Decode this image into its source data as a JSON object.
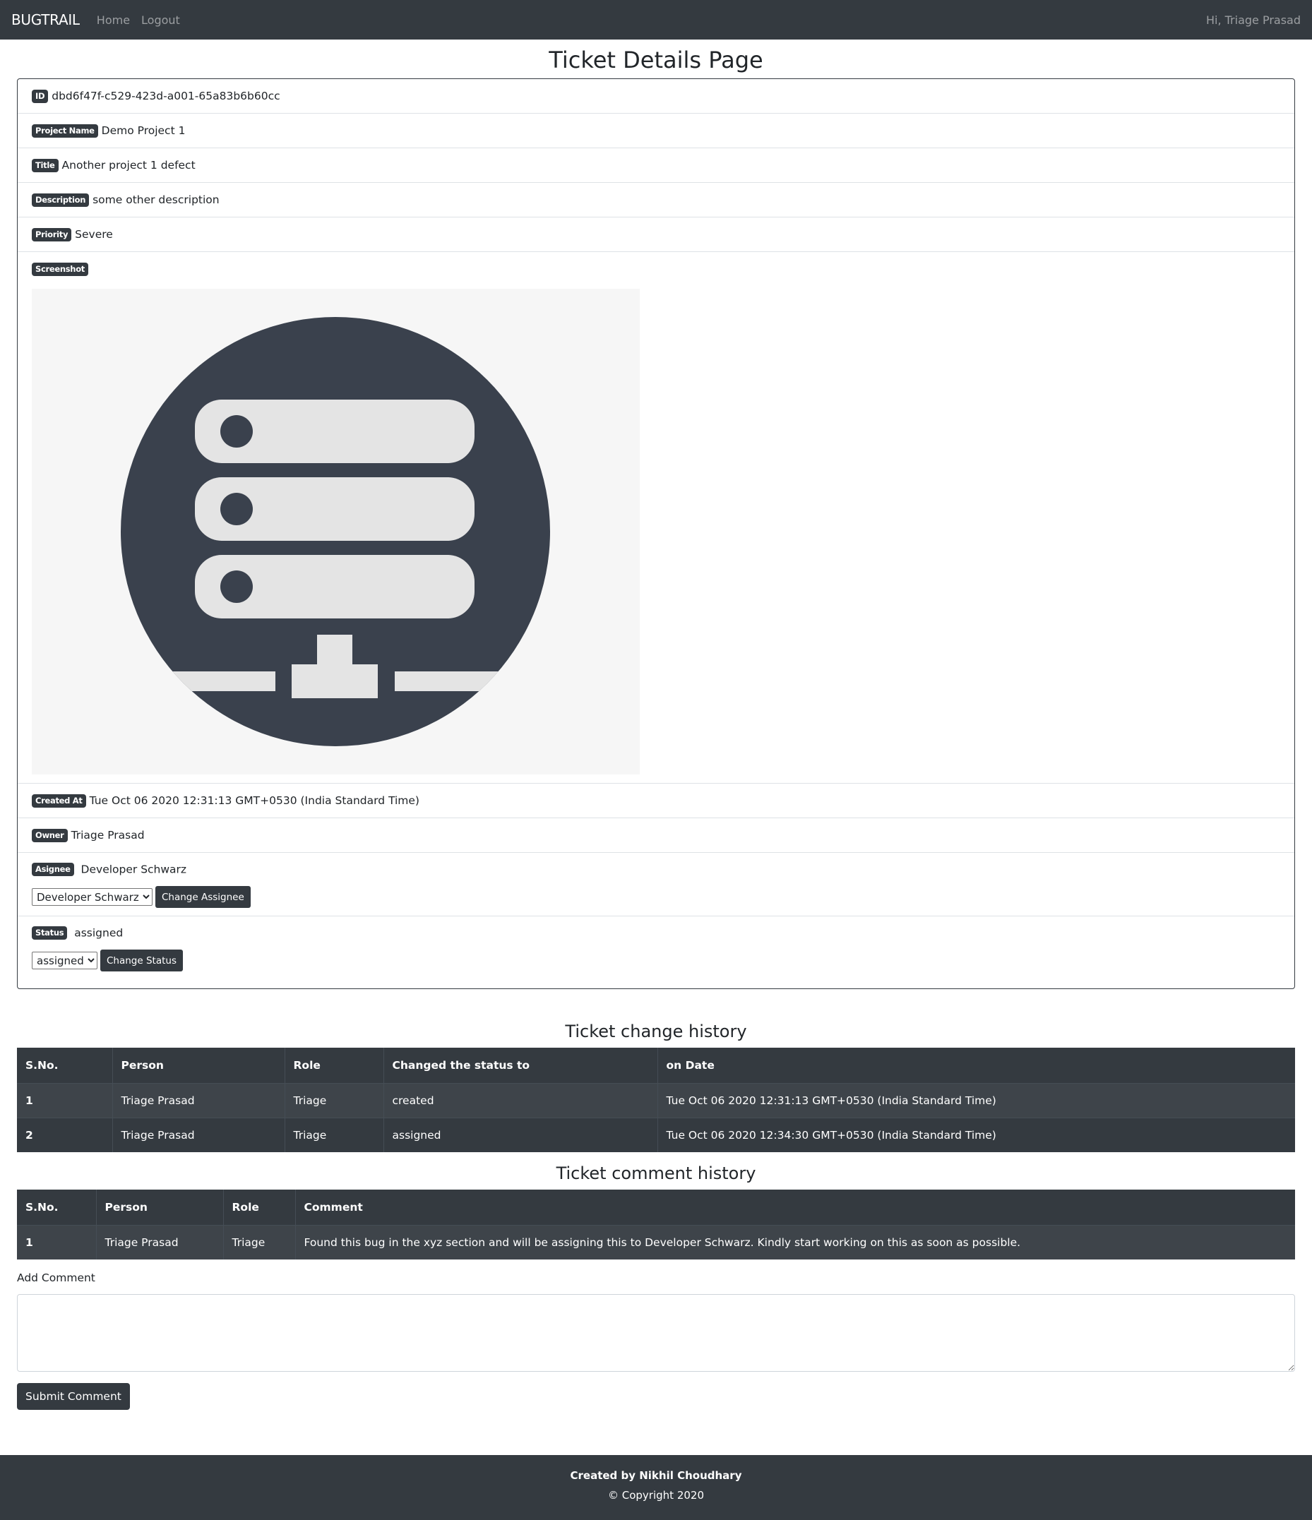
{
  "navbar": {
    "brand": "BUGTRAIL",
    "links": [
      "Home",
      "Logout"
    ],
    "greeting": "Hi, Triage Prasad"
  },
  "page_title": "Ticket Details Page",
  "ticket": {
    "id": {
      "label": "ID",
      "value": "dbd6f47f-c529-423d-a001-65a83b6b60cc"
    },
    "project_name": {
      "label": "Project Name",
      "value": "Demo Project 1"
    },
    "title": {
      "label": "Title",
      "value": "Another project 1 defect"
    },
    "description": {
      "label": "Description",
      "value": "some other description"
    },
    "priority": {
      "label": "Priority",
      "value": "Severe"
    },
    "screenshot": {
      "label": "Screenshot",
      "image_icon": "server-network-icon",
      "colors": {
        "background": "#f6f6f6",
        "circle": "#3a414d",
        "shape": "#e4e4e4"
      }
    },
    "created_at": {
      "label": "Created At",
      "value": "Tue Oct 06 2020 12:31:13 GMT+0530 (India Standard Time)"
    },
    "owner": {
      "label": "Owner",
      "value": "Triage Prasad"
    },
    "assignee": {
      "label": "Asignee",
      "value": "Developer Schwarz",
      "select_value": "Developer Schwarz",
      "button": "Change Assignee"
    },
    "status": {
      "label": "Status",
      "value": "assigned",
      "select_value": "assigned",
      "button": "Change Status"
    }
  },
  "change_history": {
    "title": "Ticket change history",
    "columns": [
      "S.No.",
      "Person",
      "Role",
      "Changed the status to",
      "on Date"
    ],
    "rows": [
      [
        "1",
        "Triage Prasad",
        "Triage",
        "created",
        "Tue Oct 06 2020 12:31:13 GMT+0530 (India Standard Time)"
      ],
      [
        "2",
        "Triage Prasad",
        "Triage",
        "assigned",
        "Tue Oct 06 2020 12:34:30 GMT+0530 (India Standard Time)"
      ]
    ]
  },
  "comment_history": {
    "title": "Ticket comment history",
    "columns": [
      "S.No.",
      "Person",
      "Role",
      "Comment"
    ],
    "rows": [
      [
        "1",
        "Triage Prasad",
        "Triage",
        "Found this bug in the xyz section and will be assigning this to Developer Schwarz. Kindly start working on this as soon as possible."
      ]
    ]
  },
  "add_comment": {
    "label": "Add Comment",
    "value": "",
    "submit": "Submit Comment"
  },
  "footer": {
    "created_by": "Created by Nikhil Choudhary",
    "copyright": "© Copyright 2020"
  },
  "colors": {
    "dark": "#343a40",
    "table_stripe": "#3e444a"
  }
}
